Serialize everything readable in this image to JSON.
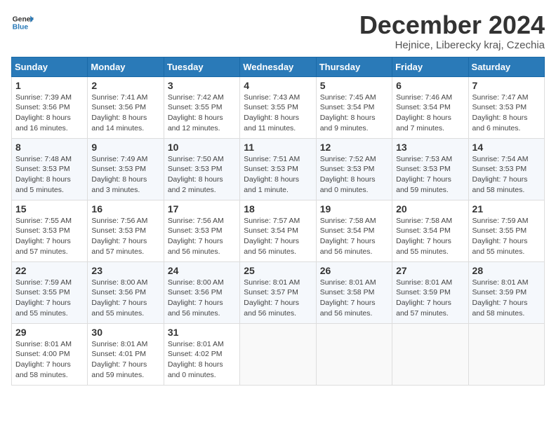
{
  "header": {
    "logo_line1": "General",
    "logo_line2": "Blue",
    "month_title": "December 2024",
    "subtitle": "Hejnice, Liberecky kraj, Czechia"
  },
  "weekdays": [
    "Sunday",
    "Monday",
    "Tuesday",
    "Wednesday",
    "Thursday",
    "Friday",
    "Saturday"
  ],
  "weeks": [
    [
      {
        "day": "1",
        "info": "Sunrise: 7:39 AM\nSunset: 3:56 PM\nDaylight: 8 hours\nand 16 minutes."
      },
      {
        "day": "2",
        "info": "Sunrise: 7:41 AM\nSunset: 3:56 PM\nDaylight: 8 hours\nand 14 minutes."
      },
      {
        "day": "3",
        "info": "Sunrise: 7:42 AM\nSunset: 3:55 PM\nDaylight: 8 hours\nand 12 minutes."
      },
      {
        "day": "4",
        "info": "Sunrise: 7:43 AM\nSunset: 3:55 PM\nDaylight: 8 hours\nand 11 minutes."
      },
      {
        "day": "5",
        "info": "Sunrise: 7:45 AM\nSunset: 3:54 PM\nDaylight: 8 hours\nand 9 minutes."
      },
      {
        "day": "6",
        "info": "Sunrise: 7:46 AM\nSunset: 3:54 PM\nDaylight: 8 hours\nand 7 minutes."
      },
      {
        "day": "7",
        "info": "Sunrise: 7:47 AM\nSunset: 3:53 PM\nDaylight: 8 hours\nand 6 minutes."
      }
    ],
    [
      {
        "day": "8",
        "info": "Sunrise: 7:48 AM\nSunset: 3:53 PM\nDaylight: 8 hours\nand 5 minutes."
      },
      {
        "day": "9",
        "info": "Sunrise: 7:49 AM\nSunset: 3:53 PM\nDaylight: 8 hours\nand 3 minutes."
      },
      {
        "day": "10",
        "info": "Sunrise: 7:50 AM\nSunset: 3:53 PM\nDaylight: 8 hours\nand 2 minutes."
      },
      {
        "day": "11",
        "info": "Sunrise: 7:51 AM\nSunset: 3:53 PM\nDaylight: 8 hours\nand 1 minute."
      },
      {
        "day": "12",
        "info": "Sunrise: 7:52 AM\nSunset: 3:53 PM\nDaylight: 8 hours\nand 0 minutes."
      },
      {
        "day": "13",
        "info": "Sunrise: 7:53 AM\nSunset: 3:53 PM\nDaylight: 7 hours\nand 59 minutes."
      },
      {
        "day": "14",
        "info": "Sunrise: 7:54 AM\nSunset: 3:53 PM\nDaylight: 7 hours\nand 58 minutes."
      }
    ],
    [
      {
        "day": "15",
        "info": "Sunrise: 7:55 AM\nSunset: 3:53 PM\nDaylight: 7 hours\nand 57 minutes."
      },
      {
        "day": "16",
        "info": "Sunrise: 7:56 AM\nSunset: 3:53 PM\nDaylight: 7 hours\nand 57 minutes."
      },
      {
        "day": "17",
        "info": "Sunrise: 7:56 AM\nSunset: 3:53 PM\nDaylight: 7 hours\nand 56 minutes."
      },
      {
        "day": "18",
        "info": "Sunrise: 7:57 AM\nSunset: 3:54 PM\nDaylight: 7 hours\nand 56 minutes."
      },
      {
        "day": "19",
        "info": "Sunrise: 7:58 AM\nSunset: 3:54 PM\nDaylight: 7 hours\nand 56 minutes."
      },
      {
        "day": "20",
        "info": "Sunrise: 7:58 AM\nSunset: 3:54 PM\nDaylight: 7 hours\nand 55 minutes."
      },
      {
        "day": "21",
        "info": "Sunrise: 7:59 AM\nSunset: 3:55 PM\nDaylight: 7 hours\nand 55 minutes."
      }
    ],
    [
      {
        "day": "22",
        "info": "Sunrise: 7:59 AM\nSunset: 3:55 PM\nDaylight: 7 hours\nand 55 minutes."
      },
      {
        "day": "23",
        "info": "Sunrise: 8:00 AM\nSunset: 3:56 PM\nDaylight: 7 hours\nand 55 minutes."
      },
      {
        "day": "24",
        "info": "Sunrise: 8:00 AM\nSunset: 3:56 PM\nDaylight: 7 hours\nand 56 minutes."
      },
      {
        "day": "25",
        "info": "Sunrise: 8:01 AM\nSunset: 3:57 PM\nDaylight: 7 hours\nand 56 minutes."
      },
      {
        "day": "26",
        "info": "Sunrise: 8:01 AM\nSunset: 3:58 PM\nDaylight: 7 hours\nand 56 minutes."
      },
      {
        "day": "27",
        "info": "Sunrise: 8:01 AM\nSunset: 3:59 PM\nDaylight: 7 hours\nand 57 minutes."
      },
      {
        "day": "28",
        "info": "Sunrise: 8:01 AM\nSunset: 3:59 PM\nDaylight: 7 hours\nand 58 minutes."
      }
    ],
    [
      {
        "day": "29",
        "info": "Sunrise: 8:01 AM\nSunset: 4:00 PM\nDaylight: 7 hours\nand 58 minutes."
      },
      {
        "day": "30",
        "info": "Sunrise: 8:01 AM\nSunset: 4:01 PM\nDaylight: 7 hours\nand 59 minutes."
      },
      {
        "day": "31",
        "info": "Sunrise: 8:01 AM\nSunset: 4:02 PM\nDaylight: 8 hours\nand 0 minutes."
      },
      null,
      null,
      null,
      null
    ]
  ]
}
